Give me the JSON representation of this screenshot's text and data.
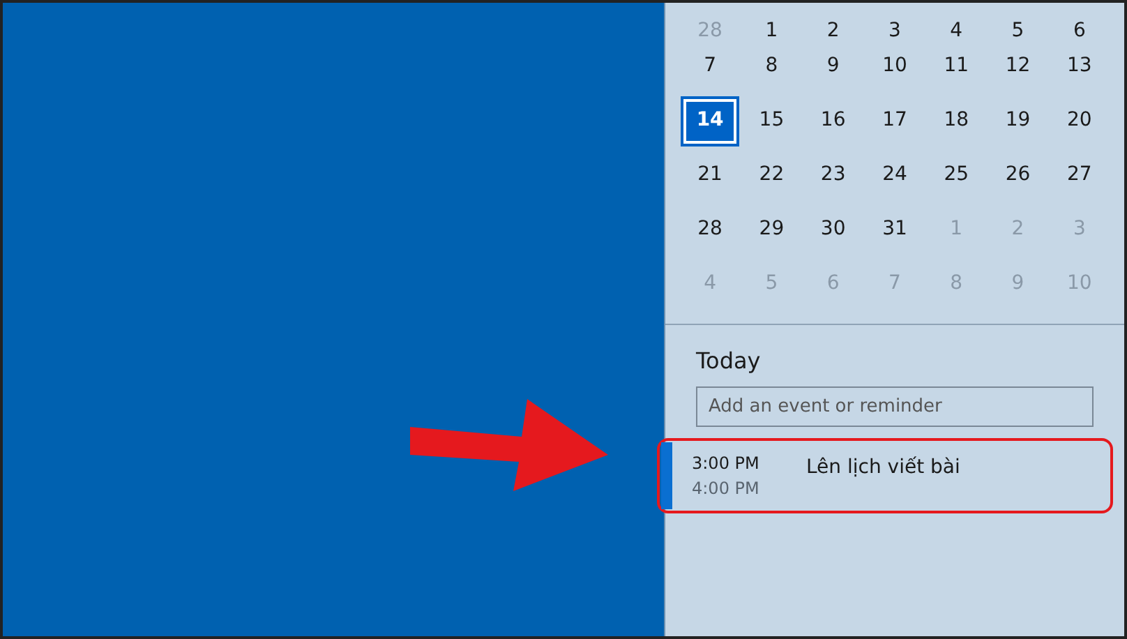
{
  "calendar": {
    "weeks": [
      [
        {
          "label": "28",
          "in_month": false,
          "selected": false
        },
        {
          "label": "1",
          "in_month": true,
          "selected": false
        },
        {
          "label": "2",
          "in_month": true,
          "selected": false
        },
        {
          "label": "3",
          "in_month": true,
          "selected": false
        },
        {
          "label": "4",
          "in_month": true,
          "selected": false
        },
        {
          "label": "5",
          "in_month": true,
          "selected": false
        },
        {
          "label": "6",
          "in_month": true,
          "selected": false
        }
      ],
      [
        {
          "label": "7",
          "in_month": true,
          "selected": false
        },
        {
          "label": "8",
          "in_month": true,
          "selected": false
        },
        {
          "label": "9",
          "in_month": true,
          "selected": false
        },
        {
          "label": "10",
          "in_month": true,
          "selected": false
        },
        {
          "label": "11",
          "in_month": true,
          "selected": false
        },
        {
          "label": "12",
          "in_month": true,
          "selected": false
        },
        {
          "label": "13",
          "in_month": true,
          "selected": false
        }
      ],
      [
        {
          "label": "14",
          "in_month": true,
          "selected": true
        },
        {
          "label": "15",
          "in_month": true,
          "selected": false
        },
        {
          "label": "16",
          "in_month": true,
          "selected": false
        },
        {
          "label": "17",
          "in_month": true,
          "selected": false
        },
        {
          "label": "18",
          "in_month": true,
          "selected": false
        },
        {
          "label": "19",
          "in_month": true,
          "selected": false
        },
        {
          "label": "20",
          "in_month": true,
          "selected": false
        }
      ],
      [
        {
          "label": "21",
          "in_month": true,
          "selected": false
        },
        {
          "label": "22",
          "in_month": true,
          "selected": false
        },
        {
          "label": "23",
          "in_month": true,
          "selected": false
        },
        {
          "label": "24",
          "in_month": true,
          "selected": false
        },
        {
          "label": "25",
          "in_month": true,
          "selected": false
        },
        {
          "label": "26",
          "in_month": true,
          "selected": false
        },
        {
          "label": "27",
          "in_month": true,
          "selected": false
        }
      ],
      [
        {
          "label": "28",
          "in_month": true,
          "selected": false
        },
        {
          "label": "29",
          "in_month": true,
          "selected": false
        },
        {
          "label": "30",
          "in_month": true,
          "selected": false
        },
        {
          "label": "31",
          "in_month": true,
          "selected": false
        },
        {
          "label": "1",
          "in_month": false,
          "selected": false
        },
        {
          "label": "2",
          "in_month": false,
          "selected": false
        },
        {
          "label": "3",
          "in_month": false,
          "selected": false
        }
      ],
      [
        {
          "label": "4",
          "in_month": false,
          "selected": false
        },
        {
          "label": "5",
          "in_month": false,
          "selected": false
        },
        {
          "label": "6",
          "in_month": false,
          "selected": false
        },
        {
          "label": "7",
          "in_month": false,
          "selected": false
        },
        {
          "label": "8",
          "in_month": false,
          "selected": false
        },
        {
          "label": "9",
          "in_month": false,
          "selected": false
        },
        {
          "label": "10",
          "in_month": false,
          "selected": false
        }
      ]
    ]
  },
  "agenda": {
    "heading": "Today",
    "add_field": {
      "placeholder": "Add an event or reminder"
    },
    "events": [
      {
        "start": "3:00 PM",
        "end": "4:00 PM",
        "title": "Lên lịch viết bài"
      }
    ]
  }
}
